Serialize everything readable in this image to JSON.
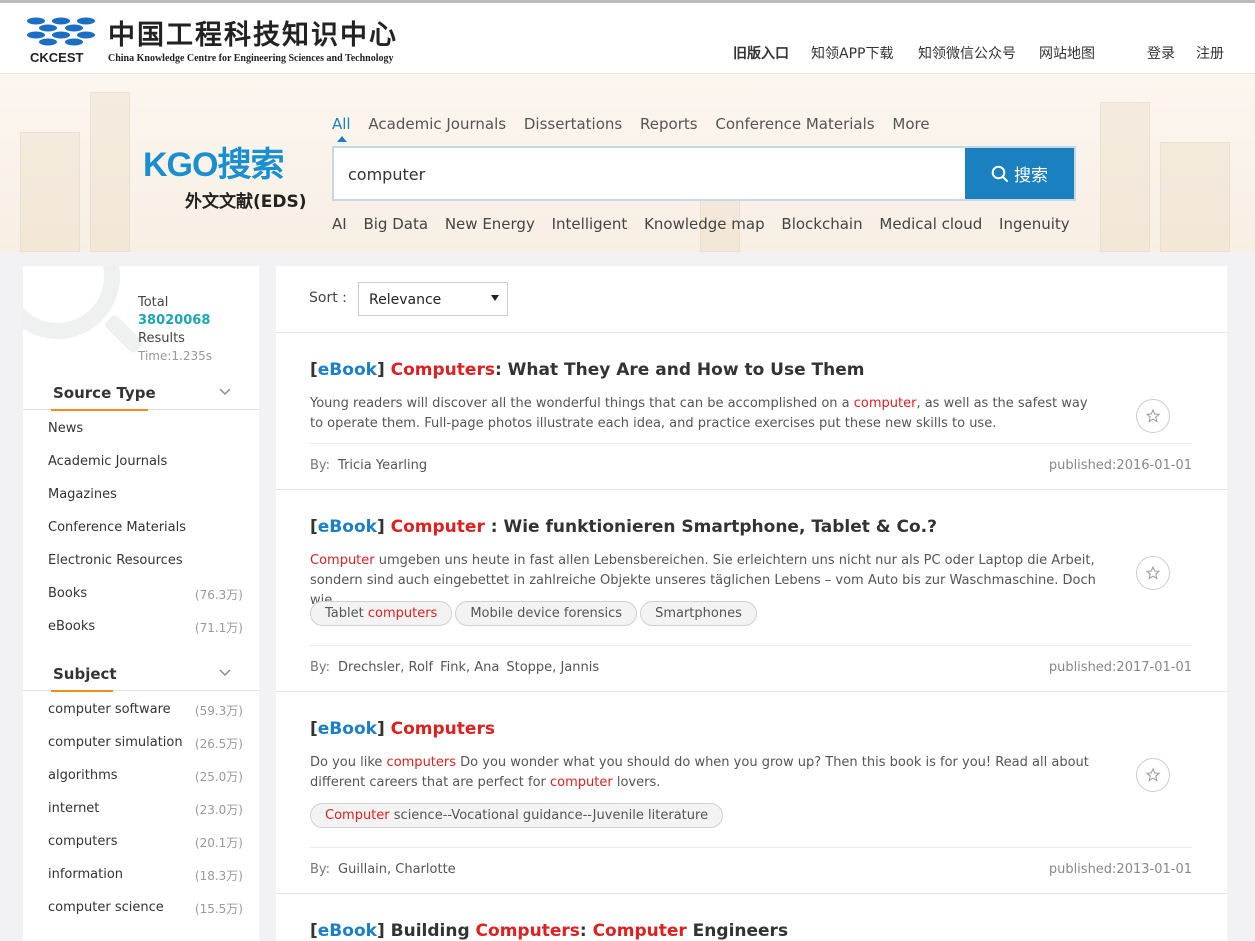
{
  "header": {
    "logo_cn": "中国工程科技知识中心",
    "logo_abbr": "CKCEST",
    "logo_en": "China Knowledge Centre for Engineering Sciences and Technology",
    "nav": [
      "旧版入口",
      "知领APP下载",
      "知领微信公众号",
      "网站地图"
    ],
    "login": "登录",
    "register": "注册"
  },
  "search": {
    "brand": "KGO搜索",
    "brand_sub": "外文文献(EDS)",
    "tabs": [
      "All",
      "Academic Journals",
      "Dissertations",
      "Reports",
      "Conference Materials",
      "More"
    ],
    "active_tab": "All",
    "query": "computer",
    "button": "搜索",
    "hot_topics": [
      "AI",
      "Big Data",
      "New Energy",
      "Intelligent",
      "Knowledge map",
      "Blockchain",
      "Medical cloud",
      "Ingenuity"
    ]
  },
  "sidebar": {
    "total_label": "Total",
    "total": "38020068",
    "results_label": "Results",
    "time": "Time:1.235s",
    "source_type": {
      "title": "Source Type",
      "items": [
        {
          "label": "News",
          "count": ""
        },
        {
          "label": "Academic Journals",
          "count": ""
        },
        {
          "label": "Magazines",
          "count": ""
        },
        {
          "label": "Conference Materials",
          "count": ""
        },
        {
          "label": "Electronic Resources",
          "count": ""
        },
        {
          "label": "Books",
          "count": "(76.3万)"
        },
        {
          "label": "eBooks",
          "count": "(71.1万)"
        }
      ]
    },
    "subject": {
      "title": "Subject",
      "items": [
        {
          "label": "computer software",
          "count": "(59.3万)"
        },
        {
          "label": "computer simulation",
          "count": "(26.5万)"
        },
        {
          "label": "algorithms",
          "count": "(25.0万)"
        },
        {
          "label": "internet",
          "count": "(23.0万)"
        },
        {
          "label": "computers",
          "count": "(20.1万)"
        },
        {
          "label": "information",
          "count": "(18.3万)"
        },
        {
          "label": "computer science",
          "count": "(15.5万)"
        }
      ]
    }
  },
  "results": {
    "sort_label": "Sort :",
    "sort_value": "Relevance",
    "by_label": "By:",
    "items": [
      {
        "type": "eBook",
        "title_hl": "Computers",
        "title_rest": ": What They Are and How to Use Them",
        "abs_before": "Young readers will discover all the wonderful things that can be accomplished on a ",
        "abs_hl": "computer",
        "abs_after": ", as well as the safest way to operate them. Full-page photos illustrate each idea, and practice exercises put these new skills to use.",
        "authors": [
          "Tricia Yearling"
        ],
        "published": "published:2016-01-01"
      },
      {
        "type": "eBook",
        "title_hl": "Computer",
        "title_rest": " : Wie funktionieren Smartphone, Tablet & Co.?",
        "abs_hl": "Computer",
        "abs_after": " umgeben uns heute in fast allen Lebensbereichen. Sie erleichtern uns nicht nur als PC oder Laptop die Arbeit, sondern sind auch eingebettet in zahlreiche Objekte unseres täglichen Lebens – vom Auto bis zur Waschmaschine. Doch wie",
        "tag1_before": "Tablet ",
        "tag1_hl": "computers",
        "tag2": "Mobile device forensics",
        "tag3": "Smartphones",
        "authors": [
          "Drechsler, Rolf",
          "Fink, Ana",
          "Stoppe, Jannis"
        ],
        "published": "published:2017-01-01"
      },
      {
        "type": "eBook",
        "title_hl": "Computers",
        "abs_before": "Do you like ",
        "abs_hl": "computers",
        "abs_mid": " Do you wonder what you should do when you grow up? Then this book is for you! Read all about different careers that are perfect for ",
        "abs_hl2": "computer",
        "abs_after": " lovers.",
        "tag1_hl": "Computer",
        "tag1_after": " science--Vocational guidance--Juvenile literature",
        "authors": [
          "Guillain, Charlotte"
        ],
        "published": "published:2013-01-01"
      },
      {
        "type": "eBook",
        "title_before": "Building ",
        "title_hl": "Computers",
        "title_mid": ": ",
        "title_hl2": "Computer",
        "title_rest": " Engineers"
      }
    ]
  }
}
